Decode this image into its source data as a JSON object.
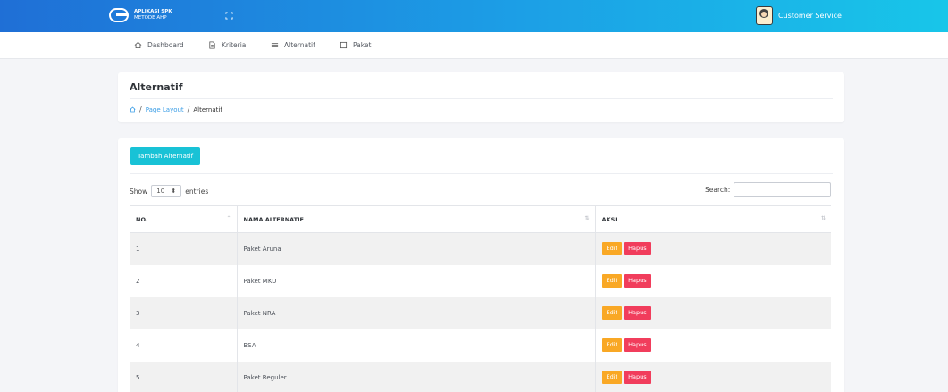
{
  "header": {
    "app_name_line1": "APLIKASI SPK",
    "app_name_line2": "METODE AHP",
    "user_name": "Customer Service"
  },
  "nav": {
    "items": [
      {
        "label": "Dashboard",
        "icon": "home-icon"
      },
      {
        "label": "Kriteria",
        "icon": "document-icon"
      },
      {
        "label": "Alternatif",
        "icon": "list-icon"
      },
      {
        "label": "Paket",
        "icon": "square-icon"
      }
    ]
  },
  "page": {
    "title": "Alternatif",
    "breadcrumb": {
      "separator": "/",
      "link": "Page Layout",
      "current": "Alternatif"
    }
  },
  "table_controls": {
    "add_button": "Tambah Alternatif",
    "show_label": "Show",
    "entries_value": "10",
    "entries_label": "entries",
    "search_label": "Search:",
    "search_value": ""
  },
  "table": {
    "columns": [
      "NO.",
      "NAMA ALTERNATIF",
      "AKSI"
    ],
    "rows": [
      {
        "no": "1",
        "nama": "Paket Aruna"
      },
      {
        "no": "2",
        "nama": "Paket MKU"
      },
      {
        "no": "3",
        "nama": "Paket NRA"
      },
      {
        "no": "4",
        "nama": "BSA"
      },
      {
        "no": "5",
        "nama": "Paket Reguler"
      }
    ],
    "edit_label": "Edit",
    "delete_label": "Hapus"
  },
  "colors": {
    "header_gradient_start": "#1f6fd6",
    "header_gradient_end": "#18c6e9",
    "add_button": "#18c2d6",
    "edit_button": "#f9a825",
    "delete_button": "#f13d5c",
    "link": "#3a9de6"
  }
}
